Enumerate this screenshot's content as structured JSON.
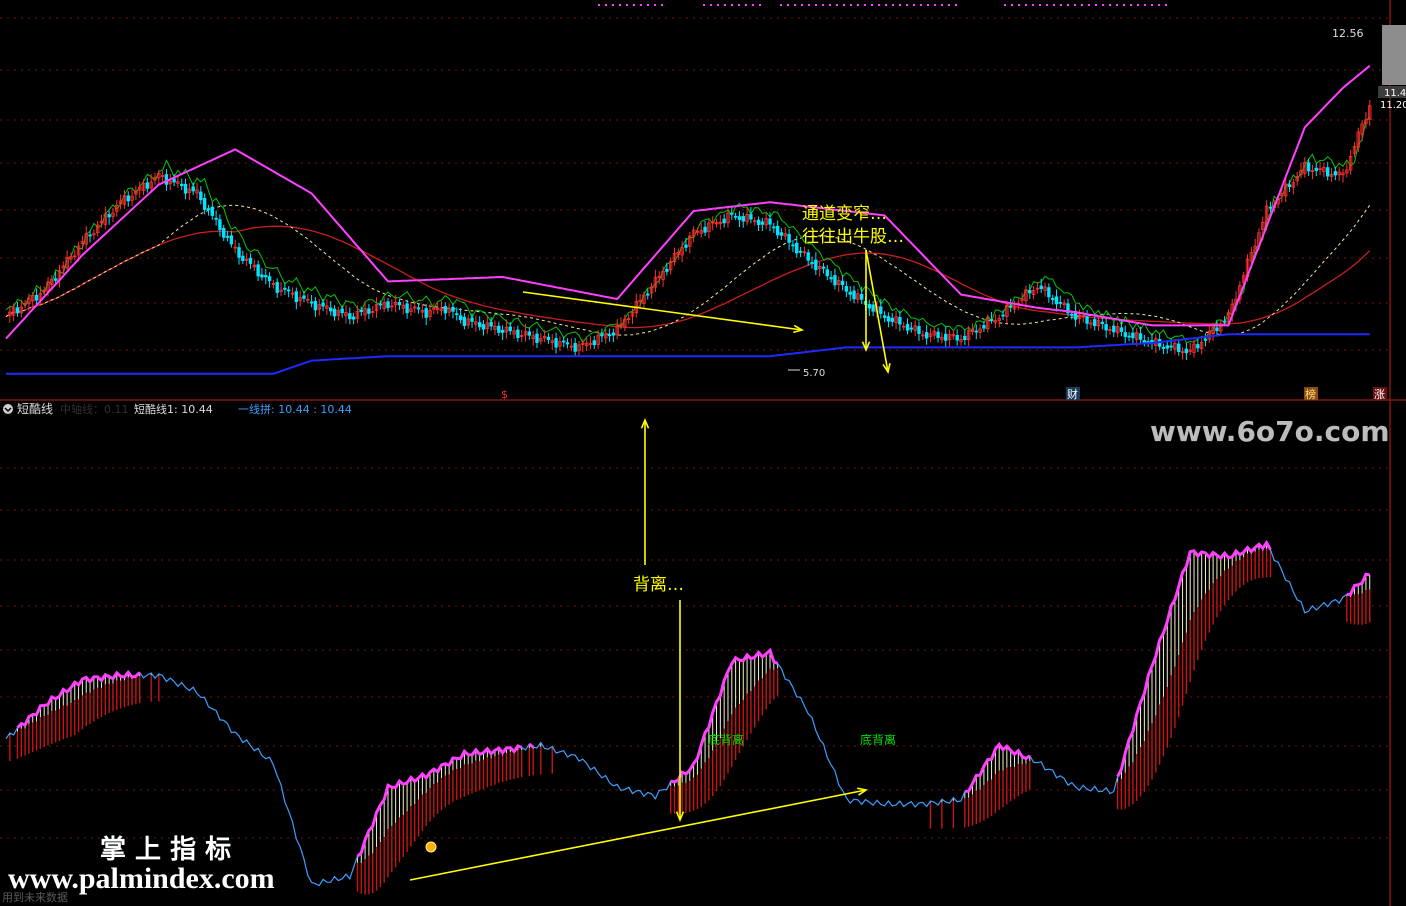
{
  "main": {
    "price_labels": [
      "12.56",
      "11.4",
      "11.20"
    ],
    "low_label": "5.70",
    "markers": [
      "$",
      "财",
      "榜",
      "涨"
    ],
    "annotation_narrowing_1": "通道变窄…",
    "annotation_narrowing_2": "往往出牛股…",
    "colors": {
      "candle_up": "#ff3030",
      "candle_down": "#00e5ff",
      "upper_band": "#ff40ff",
      "inner_band": "#00c800",
      "lower_band": "#1e2aff",
      "ma_long": "#c81e1e",
      "ma_dashed": "#f5e6a0",
      "arrow": "#ffff00"
    }
  },
  "indicator": {
    "name": "短酷线",
    "faded_label": "中轴线：0.11",
    "line1": "短酷线1: 10.44",
    "line2": "一线拼: 10.44 : 10.44",
    "divergence_label": "底背离",
    "divergence_note": "背离…",
    "colors": {
      "main_line": "#3aa0ff",
      "highlight": "#ff40ff",
      "bar_red": "#c81414",
      "bar_light": "#f5f0c8"
    }
  },
  "footer": {
    "disclaimer": "用到未来数据"
  },
  "watermarks": {
    "site_top": "www.6o7o.com",
    "brand_cn": "掌 上 指 标",
    "site_bottom": "www.palmindex.com"
  },
  "chart_data": {
    "type": "line",
    "title": "",
    "xlabel": "",
    "ylabel": "",
    "panels": [
      {
        "name": "price",
        "y_ticks_visible": [
          "12.56",
          "11.20"
        ],
        "low_marker": 5.7,
        "series": [
          {
            "name": "",
            "role": "close (candles)",
            "x": [
              0,
              10,
              20,
              30,
              40,
              50,
              60,
              70,
              80,
              90,
              100,
              110,
              115,
              120,
              130,
              140,
              150,
              160,
              170,
              180,
              190,
              200,
              210,
              220,
              230,
              240,
              250,
              260,
              270,
              280,
              290,
              300,
              310,
              320,
              330,
              340,
              350,
              357
            ],
            "values": [
              6.6,
              7.2,
              8.3,
              9.2,
              9.8,
              9.4,
              8.1,
              7.3,
              6.9,
              6.6,
              6.9,
              6.7,
              6.8,
              6.5,
              6.3,
              6.1,
              5.9,
              6.3,
              7.4,
              8.5,
              8.9,
              8.7,
              7.9,
              7.2,
              6.6,
              6.2,
              6.1,
              6.6,
              7.3,
              6.6,
              6.3,
              6.0,
              5.8,
              6.6,
              9.0,
              10.0,
              9.8,
              11.4
            ]
          },
          {
            "name": "",
            "role": "upper band",
            "x": [
              0,
              20,
              40,
              60,
              80,
              100,
              130,
              160,
              180,
              200,
              230,
              250,
              270,
              280,
              300,
              320,
              340,
              350,
              357
            ],
            "values": [
              6.1,
              8.0,
              9.6,
              10.4,
              9.4,
              7.4,
              7.5,
              7.0,
              9.0,
              9.2,
              8.9,
              7.1,
              6.8,
              6.7,
              6.4,
              6.4,
              10.9,
              11.8,
              12.3
            ]
          },
          {
            "name": "",
            "role": "lower band",
            "x": [
              0,
              70,
              80,
              100,
              160,
              200,
              220,
              240,
              280,
              300,
              320,
              357
            ],
            "values": [
              5.3,
              5.3,
              5.6,
              5.7,
              5.7,
              5.7,
              5.9,
              5.9,
              5.9,
              6.0,
              6.2,
              6.2
            ]
          }
        ]
      },
      {
        "name": "短酷线",
        "series": [
          {
            "name": "短酷线1",
            "x": [
              0,
              10,
              20,
              30,
              40,
              50,
              60,
              70,
              80,
              90,
              100,
              110,
              120,
              130,
              140,
              150,
              160,
              170,
              180,
              190,
              200,
              210,
              220,
              230,
              240,
              250,
              260,
              270,
              280,
              290,
              300,
              310,
              320,
              330,
              340,
              350,
              357
            ],
            "values": [
              7.6,
              8.4,
              9.0,
              9.1,
              9.1,
              8.7,
              7.7,
              7.0,
              4.1,
              4.3,
              6.4,
              6.7,
              7.2,
              7.3,
              7.4,
              7.1,
              6.4,
              6.2,
              6.9,
              9.4,
              9.6,
              8.2,
              6.1,
              6.0,
              6.0,
              6.1,
              7.4,
              7.0,
              6.4,
              6.3,
              9.3,
              12.0,
              11.9,
              12.2,
              10.6,
              10.9,
              11.5
            ]
          }
        ]
      }
    ]
  }
}
